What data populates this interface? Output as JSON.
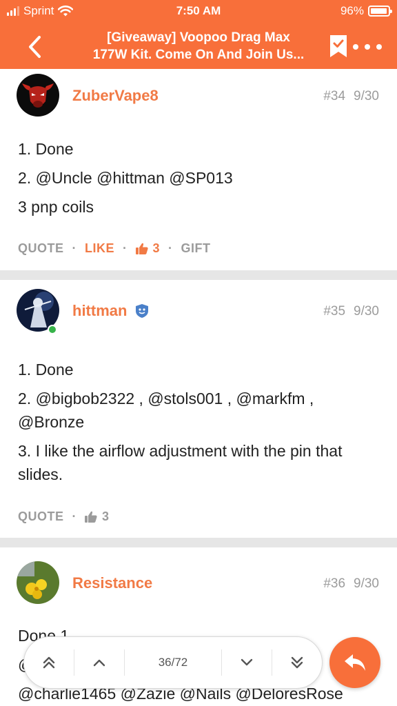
{
  "status_bar": {
    "carrier": "Sprint",
    "time": "7:50 AM",
    "battery": "96%",
    "battery_level": 0.96
  },
  "nav": {
    "title_line1": "[Giveaway] Voopoo Drag Max",
    "title_line2": "177W Kit. Come On And Join Us..."
  },
  "posts": [
    {
      "username": "ZuberVape8",
      "post_number": "#34",
      "date": "9/30",
      "lines": [
        "1. Done",
        "2. @Uncle @hittman @SP013",
        "3 pnp coils"
      ],
      "actions": {
        "quote": "QUOTE",
        "like": "LIKE",
        "likes": "3",
        "gift": "GIFT"
      }
    },
    {
      "username": "hittman",
      "post_number": "#35",
      "date": "9/30",
      "lines": [
        "1. Done",
        "2. @bigbob2322 , @stols001 , @markfm , @Bronze",
        "3. I like the airflow adjustment with the pin that slides."
      ],
      "actions": {
        "quote": "QUOTE",
        "likes": "3"
      }
    },
    {
      "username": "Resistance",
      "post_number": "#36",
      "date": "9/30",
      "lines": [
        "Done 1",
        "@",
        "@charlie1465 @Zazie @Nails @DeloresRose"
      ]
    }
  ],
  "pager": {
    "count": "36/72"
  },
  "colors": {
    "accent": "#f86f3a",
    "username": "#f17a45",
    "meta": "#9b9b9b",
    "online": "#37b34a"
  },
  "icons": [
    "back-chevron-icon",
    "bookmark-check-icon",
    "more-dots-icon",
    "thumbs-up-icon",
    "moderator-badge-icon",
    "reply-arrow-icon"
  ]
}
